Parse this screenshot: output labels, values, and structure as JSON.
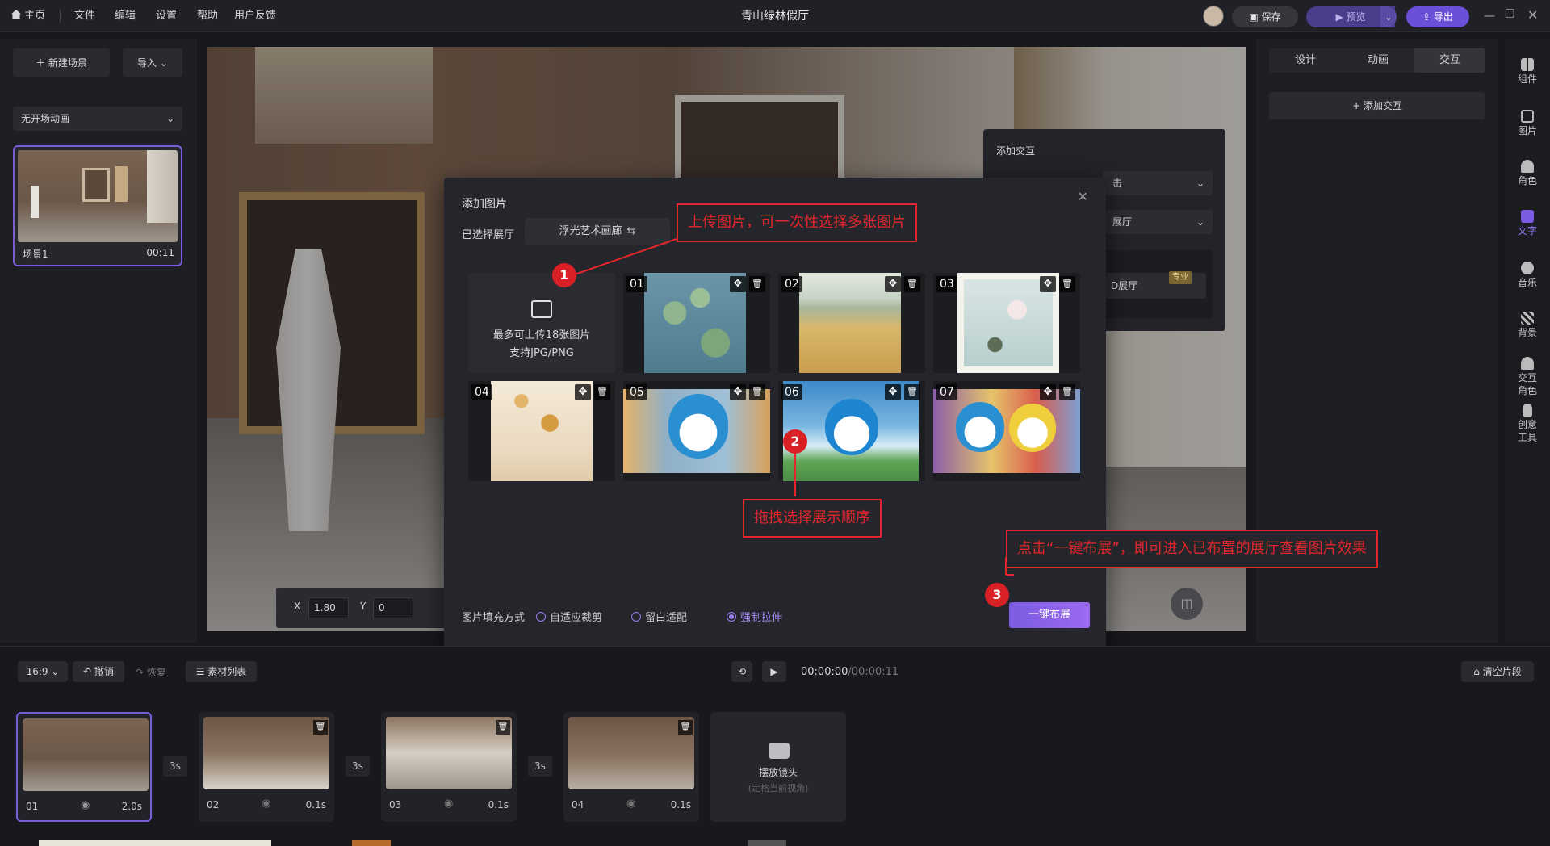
{
  "topbar": {
    "home": "主页",
    "menus": [
      "文件",
      "编辑",
      "设置",
      "帮助",
      "用户反馈"
    ],
    "title": "青山绿林假厅",
    "save": "保存",
    "preview": "预览",
    "export": "导出"
  },
  "left": {
    "new_scene": "新建场景",
    "import": "导入",
    "transition": "无开场动画",
    "scene_name": "场景1",
    "scene_time": "00:11"
  },
  "canvas": {
    "x_label": "X",
    "x_value": "1.80",
    "y_label": "Y",
    "y_value": "0"
  },
  "right_panel": {
    "tabs": [
      "设计",
      "动画",
      "交互"
    ],
    "add_interaction": "+ 添加交互"
  },
  "right_side": [
    {
      "label": "组件"
    },
    {
      "label": "图片"
    },
    {
      "label": "角色"
    },
    {
      "label": "文字"
    },
    {
      "label": "音乐"
    },
    {
      "label": "背景"
    },
    {
      "label": "交互\n角色"
    },
    {
      "label": "创意\n工具"
    }
  ],
  "interact_panel": {
    "title": "添加交互",
    "field1": "击",
    "field2": "展厅",
    "field3": "D展厅",
    "pro": "专业"
  },
  "dialog": {
    "title": "添加图片",
    "hall_label": "已选择展厅",
    "hall_value": "浮光艺术画廊",
    "upload_line1": "最多可上传18张图片",
    "upload_line2": "支持JPG/PNG",
    "images": [
      "01",
      "02",
      "03",
      "04",
      "05",
      "06",
      "07"
    ],
    "fill_label": "图片填充方式",
    "fill_options": [
      "自适应裁剪",
      "留白适配",
      "强制拉伸"
    ],
    "fill_selected": "强制拉伸",
    "action": "一键布展"
  },
  "callouts": {
    "c1": "上传图片，可一次性选择多张图片",
    "c2": "拖拽选择展示顺序",
    "c3": "点击“一键布展”，即可进入已布置的展厅查看图片效果",
    "b1": "1",
    "b2": "2",
    "b3": "3"
  },
  "timeline": {
    "ratio": "16:9",
    "undo": "撤销",
    "redo": "恢复",
    "assets": "素材列表",
    "time_current": "00:00:00",
    "time_total": "/00:00:11",
    "clear": "清空片段",
    "clips": [
      {
        "label": "01",
        "dur": "2.0s"
      },
      {
        "label": "02",
        "dur": "0.1s"
      },
      {
        "label": "03",
        "dur": "0.1s"
      },
      {
        "label": "04",
        "dur": "0.1s"
      }
    ],
    "gaps": [
      "3s",
      "3s",
      "3s"
    ],
    "camera_label": "摆放镜头",
    "camera_sub": "(定格当前视角)"
  },
  "colors": {
    "accent": "#7c5ce0",
    "red": "#e3262c",
    "bg": "#17181c"
  }
}
